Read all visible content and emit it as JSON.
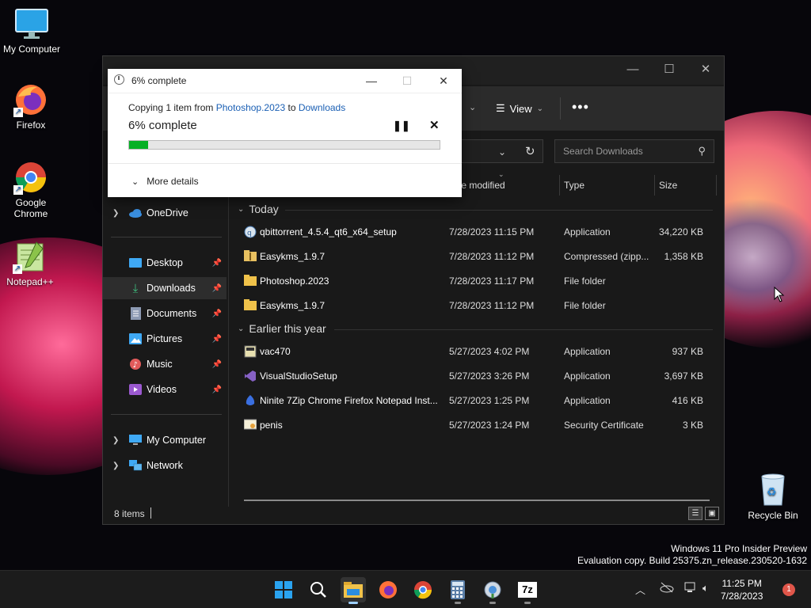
{
  "desktop": {
    "icons": [
      {
        "label": "My Computer"
      },
      {
        "label": "Firefox"
      },
      {
        "label": "Google Chrome"
      },
      {
        "label": "Notepad++"
      }
    ],
    "recycle_bin": {
      "label": "Recycle Bin"
    },
    "watermark": {
      "line1": "Windows 11 Pro Insider Preview",
      "line2": "Evaluation copy. Build 25375.zn_release.230520-1632"
    }
  },
  "copy_dialog": {
    "title": "6% complete",
    "copying_prefix": "Copying 1 item from",
    "source": "Photoshop.2023",
    "to_word": "to",
    "destination": "Downloads",
    "percent_text": "6% complete",
    "progress_percent": 6,
    "more_details": "More details",
    "colors": {
      "progress": "#06b025",
      "link": "#1a5fb4"
    }
  },
  "explorer": {
    "toolbar": {
      "view_label": "View"
    },
    "search": {
      "placeholder": "Search Downloads"
    },
    "columns": {
      "date": "te modified",
      "type": "Type",
      "size": "Size"
    },
    "nav": {
      "onedrive": "OneDrive",
      "desktop": "Desktop",
      "downloads": "Downloads",
      "documents": "Documents",
      "pictures": "Pictures",
      "music": "Music",
      "videos": "Videos",
      "my_computer": "My Computer",
      "network": "Network"
    },
    "groups": [
      {
        "title": "Today",
        "files": [
          {
            "name": "qbittorrent_4.5.4_qt6_x64_setup",
            "date": "7/28/2023 11:15 PM",
            "type": "Application",
            "size": "34,220 KB",
            "icon": "qbittorrent-icon"
          },
          {
            "name": "Easykms_1.9.7",
            "date": "7/28/2023 11:12 PM",
            "type": "Compressed (zipp...",
            "size": "1,358 KB",
            "icon": "zip-folder-icon"
          },
          {
            "name": "Photoshop.2023",
            "date": "7/28/2023 11:17 PM",
            "type": "File folder",
            "size": "",
            "icon": "folder-icon"
          },
          {
            "name": "Easykms_1.9.7",
            "date": "7/28/2023 11:12 PM",
            "type": "File folder",
            "size": "",
            "icon": "folder-icon"
          }
        ]
      },
      {
        "title": "Earlier this year",
        "files": [
          {
            "name": "vac470",
            "date": "5/27/2023 4:02 PM",
            "type": "Application",
            "size": "937 KB",
            "icon": "app-icon"
          },
          {
            "name": "VisualStudioSetup",
            "date": "5/27/2023 3:26 PM",
            "type": "Application",
            "size": "3,697 KB",
            "icon": "visual-studio-icon"
          },
          {
            "name": "Ninite 7Zip Chrome Firefox Notepad Inst...",
            "date": "5/27/2023 1:25 PM",
            "type": "Application",
            "size": "416 KB",
            "icon": "ninite-icon"
          },
          {
            "name": "penis",
            "date": "5/27/2023 1:24 PM",
            "type": "Security Certificate",
            "size": "3 KB",
            "icon": "certificate-icon"
          }
        ]
      }
    ],
    "status": {
      "item_count": "8 items"
    }
  },
  "taskbar": {
    "clock_time": "11:25 PM",
    "clock_date": "7/28/2023",
    "notification_count": "1",
    "seven_zip_label": "7z"
  }
}
